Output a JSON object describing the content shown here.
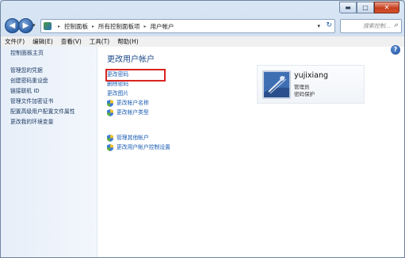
{
  "window": {
    "caption_buttons": {
      "minimize": "▬",
      "maximize": "□",
      "close": "✕"
    }
  },
  "navigation": {
    "back_icon": "back-arrow-icon",
    "forward_icon": "forward-arrow-icon",
    "address": {
      "crumbs": [
        "控制面板",
        "所有控制面板项",
        "用户帐户"
      ],
      "separator": "▸"
    },
    "search_placeholder": "搜索控制..."
  },
  "menu": {
    "items": [
      "文件(F)",
      "编辑(E)",
      "查看(V)",
      "工具(T)",
      "帮助(H)"
    ]
  },
  "sidebar": {
    "home": "控制面板主页",
    "links": [
      "管理您的凭据",
      "创建密码重设盘",
      "链接联机 ID",
      "管理文件加密证书",
      "配置高级用户配置文件属性",
      "更改我的环境变量"
    ]
  },
  "main": {
    "title": "更改用户帐户",
    "tasks": [
      {
        "label": "更改密码",
        "shield": false,
        "highlighted": true
      },
      {
        "label": "删除密码",
        "shield": false
      },
      {
        "label": "更改图片",
        "shield": false
      },
      {
        "label": "更改帐户名称",
        "shield": true
      },
      {
        "label": "更改帐户类型",
        "shield": true
      }
    ],
    "tasks2": [
      {
        "label": "管理其他帐户",
        "shield": true
      },
      {
        "label": "更改用户帐户控制设置",
        "shield": true
      }
    ]
  },
  "user": {
    "name": "yujixiang",
    "role": "管理员",
    "password_status": "密码保护"
  },
  "colors": {
    "highlight": "#d9241f",
    "link": "#1a5cb3",
    "title": "#1b4a8a"
  }
}
